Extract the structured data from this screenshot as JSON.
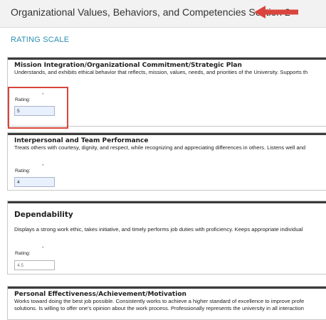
{
  "section": {
    "title": "Organizational Values, Behaviors, and Competencies Section 2",
    "rating_scale_link": "RATING SCALE"
  },
  "competencies": [
    {
      "title": "Mission Integration/Organizational Commitment/Strategic Plan",
      "description": "Understands, and exhibits ethical behavior that reflects, mission, values, needs, and priorities of the University. Supports th",
      "rating_label": "Rating:",
      "rating_value": "5"
    },
    {
      "title": "Interpersonal and Team Performance",
      "description": "Treats others with courtesy, dignity, and respect, while recognizing and appreciating differences in others. Listens well and",
      "rating_label": "Rating:",
      "rating_value": "4"
    },
    {
      "title": "Dependability",
      "description": "Displays a strong work ethic, takes initiative, and timely performs job duties with proficiency. Keeps appropriate individual",
      "rating_label": "Rating:",
      "rating_value": "4.5"
    },
    {
      "title": "Personal Effectiveness/Achievement/Motivation",
      "description_lines": [
        "Works toward doing the best job possible. Consistently works to achieve a higher standard of excellence to improve profe",
        "solutions. Is willing to offer one's opinion about the work process. Professionally represents the university in all interaction"
      ]
    }
  ],
  "required_marker": "*",
  "annotations": {
    "arrow_color": "#d9453d",
    "box_color": "#d9453d"
  },
  "colors": {
    "link": "#2b8fb3",
    "input_filled": "#e8f0fe",
    "header_bg": "#f2f2f2"
  }
}
